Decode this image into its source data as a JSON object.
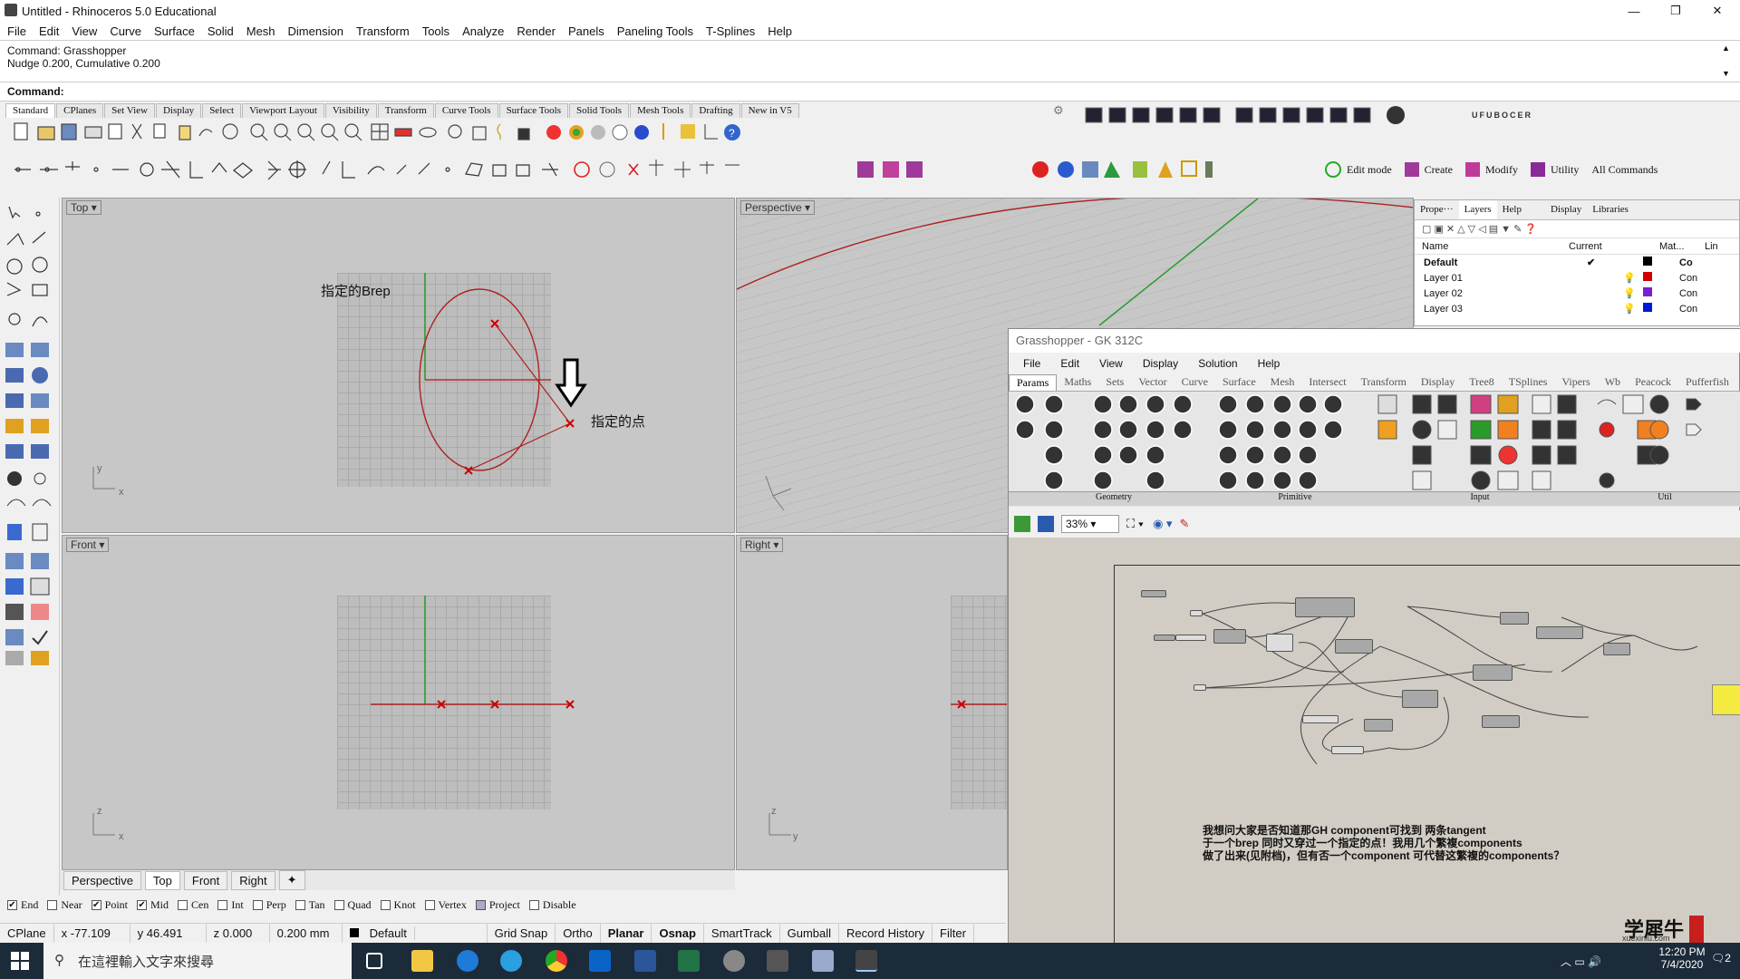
{
  "app": {
    "title": "Untitled - Rhinoceros 5.0 Educational",
    "win_controls": [
      "—",
      "❐",
      "✕"
    ]
  },
  "menu": [
    "File",
    "Edit",
    "View",
    "Curve",
    "Surface",
    "Solid",
    "Mesh",
    "Dimension",
    "Transform",
    "Tools",
    "Analyze",
    "Render",
    "Panels",
    "Paneling Tools",
    "T-Splines",
    "Help"
  ],
  "command": {
    "history_1": "Command: Grasshopper",
    "history_2": "Nudge 0.200, Cumulative 0.200",
    "prompt": "Command:"
  },
  "toolbar_tabs": [
    "Standard",
    "CPlanes",
    "Set View",
    "Display",
    "Select",
    "Viewport Layout",
    "Visibility",
    "Transform",
    "Curve Tools",
    "Surface Tools",
    "Solid Tools",
    "Mesh Tools",
    "Drafting",
    "New in V5"
  ],
  "ufo_label": "UFUBOCER",
  "tsplines_bar": {
    "edit": "Edit mode",
    "create": "Create",
    "modify": "Modify",
    "utility": "Utility",
    "all": "All Commands"
  },
  "viewports": {
    "top": {
      "label": "Top",
      "annotation_brep": "指定的Brep",
      "annotation_point": "指定的点"
    },
    "perspective": {
      "label": "Perspective"
    },
    "front": {
      "label": "Front"
    },
    "right": {
      "label": "Right"
    }
  },
  "axes": {
    "x": "x",
    "y": "y",
    "z": "z"
  },
  "viewport_tabs": [
    "Perspective",
    "Top",
    "Front",
    "Right"
  ],
  "viewport_tabs_add": "✦",
  "osnap": [
    {
      "label": "End",
      "checked": true
    },
    {
      "label": "Near",
      "checked": false
    },
    {
      "label": "Point",
      "checked": true
    },
    {
      "label": "Mid",
      "checked": true
    },
    {
      "label": "Cen",
      "checked": false
    },
    {
      "label": "Int",
      "checked": false
    },
    {
      "label": "Perp",
      "checked": false
    },
    {
      "label": "Tan",
      "checked": false
    },
    {
      "label": "Quad",
      "checked": false
    },
    {
      "label": "Knot",
      "checked": false
    },
    {
      "label": "Vertex",
      "checked": false
    },
    {
      "label": "Project",
      "checked": false
    },
    {
      "label": "Disable",
      "checked": false
    }
  ],
  "status": {
    "cplane": "CPlane",
    "x": "x -77.109",
    "y": "y 46.491",
    "z": "z 0.000",
    "units": "0.200 mm",
    "layer": "Default",
    "grid_snap": "Grid Snap",
    "ortho": "Ortho",
    "planar": "Planar",
    "osnap": "Osnap",
    "smarttrack": "SmartTrack",
    "gumball": "Gumball",
    "record_history": "Record History",
    "filter": "Filter"
  },
  "layers_panel": {
    "tabs": [
      "Prope···",
      "Layers",
      "Help",
      "Display",
      "Libraries"
    ],
    "columns": [
      "Name",
      "Current",
      "Mat...",
      "Lin"
    ],
    "rows": [
      {
        "name": "Default",
        "current": "✔",
        "color": "#000000",
        "linetype": "Co"
      },
      {
        "name": "Layer 01",
        "current": "",
        "color": "#d40000",
        "linetype": "Con"
      },
      {
        "name": "Layer 02",
        "current": "",
        "color": "#7a1fd0",
        "linetype": "Con"
      },
      {
        "name": "Layer 03",
        "current": "",
        "color": "#0018d8",
        "linetype": "Con"
      }
    ]
  },
  "grasshopper": {
    "title": "Grasshopper - GK 312C",
    "menu": [
      "File",
      "Edit",
      "View",
      "Display",
      "Solution",
      "Help"
    ],
    "tabs": [
      "Params",
      "Maths",
      "Sets",
      "Vector",
      "Curve",
      "Surface",
      "Mesh",
      "Intersect",
      "Transform",
      "Display",
      "Tree8",
      "TSplines",
      "Vipers",
      "Wb",
      "Peacock",
      "Pufferfish"
    ],
    "groups": [
      "Geometry",
      "Primitive",
      "Input",
      "Util"
    ],
    "zoom": "33%",
    "note_1": "我想问大家是否知道那GH component可找到 两条tangent",
    "note_2": "于一个brep 同时又穿过一个指定的点！我用几个繁複components",
    "note_3": "做了出来(见附档)，但有否一个component 可代替这繁複的components？"
  },
  "watermark": {
    "title": "学犀牛",
    "sub": "xuexiniu.com"
  },
  "taskbar": {
    "search_placeholder": "在這裡輸入文字來搜尋",
    "time": "12:20 PM",
    "date": "7/4/2020",
    "notifications": "2"
  }
}
